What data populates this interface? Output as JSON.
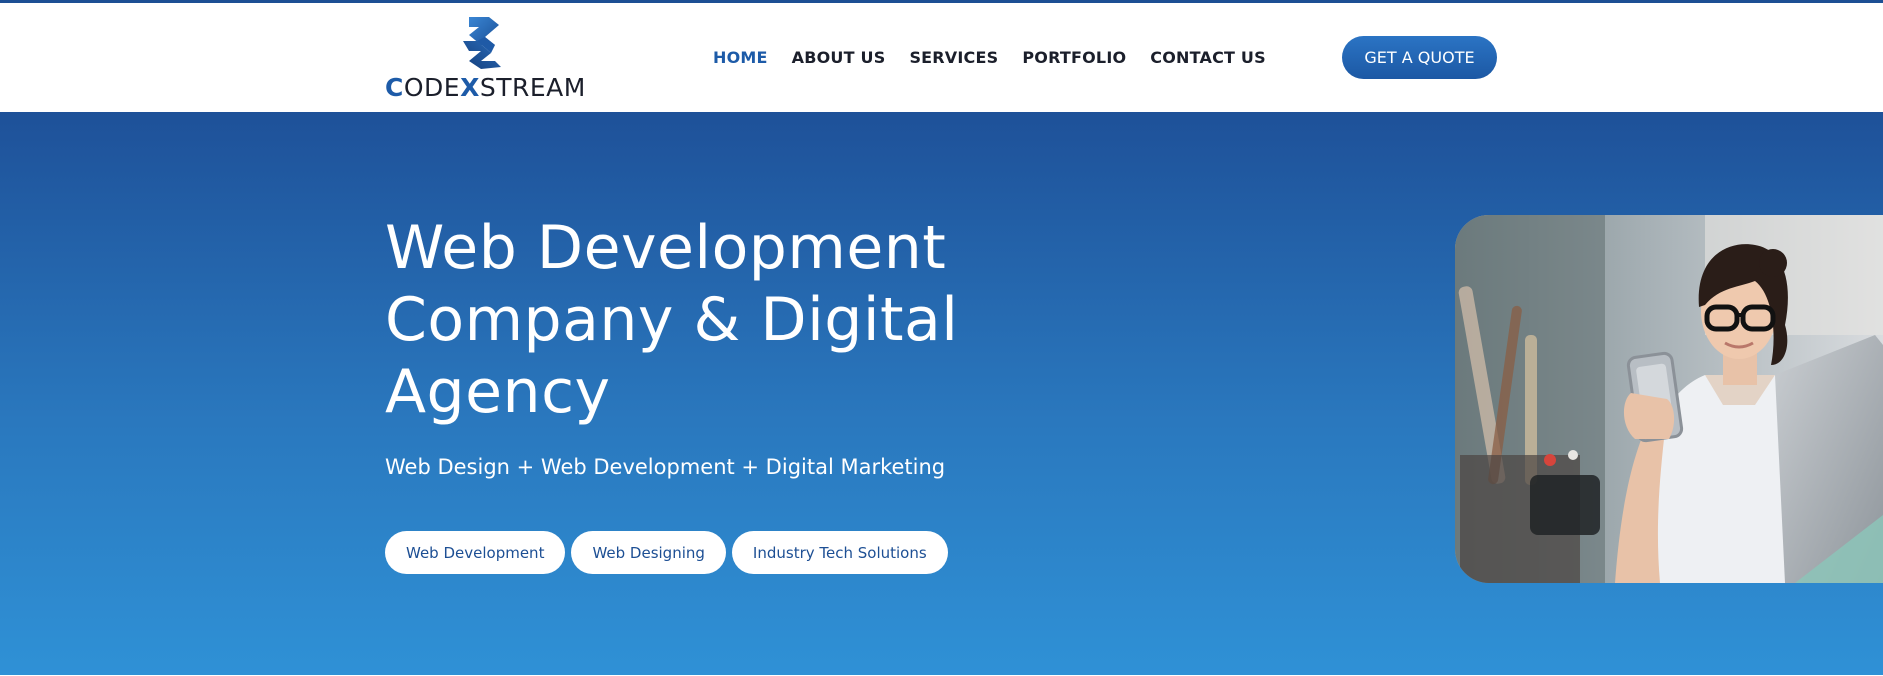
{
  "brand": {
    "logo_text_c": "C",
    "logo_text_ode": "ODE",
    "logo_text_x": "X",
    "logo_text_stream": "STREAM"
  },
  "nav": {
    "items": [
      {
        "label": "HOME",
        "active": true
      },
      {
        "label": "ABOUT US",
        "active": false
      },
      {
        "label": "SERVICES",
        "active": false
      },
      {
        "label": "PORTFOLIO",
        "active": false
      },
      {
        "label": "CONTACT US",
        "active": false
      }
    ]
  },
  "header": {
    "quote_button": "GET A QUOTE"
  },
  "hero": {
    "title_line1": "Web Development",
    "title_line2": "Company & Digital",
    "title_line3": "Agency",
    "subtitle": "Web Design + Web Development + Digital Marketing",
    "pills": [
      "Web Development",
      "Web Designing",
      "Industry Tech Solutions"
    ]
  },
  "colors": {
    "brand_blue": "#1d5ba8",
    "hero_top": "#1e5199",
    "hero_bottom": "#2f91d6",
    "text_dark": "#1b1f2b"
  },
  "icons": {
    "logo_mark": "interlocking-cube-logo-icon"
  }
}
